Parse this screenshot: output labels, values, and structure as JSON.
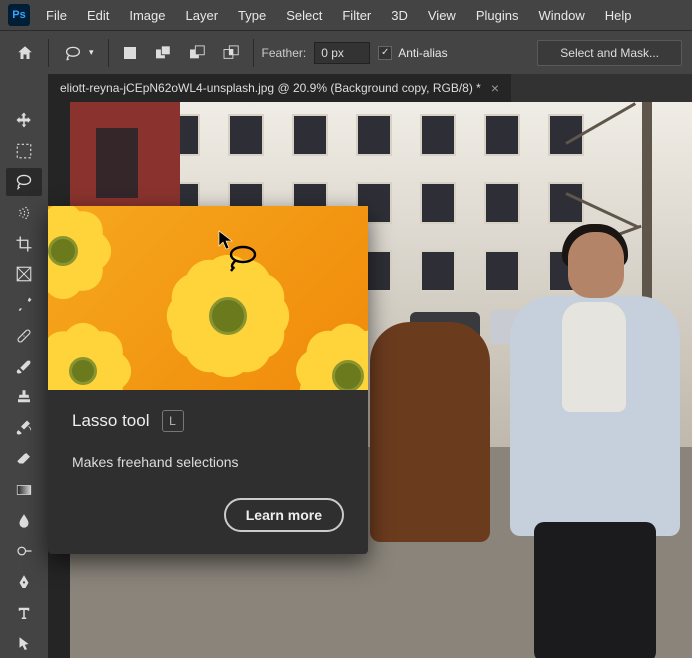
{
  "menu": [
    "File",
    "Edit",
    "Image",
    "Layer",
    "Type",
    "Select",
    "Filter",
    "3D",
    "View",
    "Plugins",
    "Window",
    "Help"
  ],
  "options": {
    "feather_label": "Feather:",
    "feather_value": "0 px",
    "antialias": "Anti-alias",
    "mask_button": "Select and Mask..."
  },
  "tab": {
    "title": "eliott-reyna-jCEpN62oWL4-unsplash.jpg @ 20.9% (Background copy, RGB/8) *"
  },
  "tooltip": {
    "title": "Lasso tool",
    "shortcut": "L",
    "desc": "Makes freehand selections",
    "learn": "Learn more"
  },
  "tools": [
    "move",
    "marquee",
    "lasso",
    "object-select",
    "crop",
    "frame",
    "eyedropper",
    "healing",
    "brush",
    "clone",
    "history-brush",
    "eraser",
    "gradient",
    "blur",
    "dodge",
    "pen",
    "type",
    "path-select"
  ]
}
